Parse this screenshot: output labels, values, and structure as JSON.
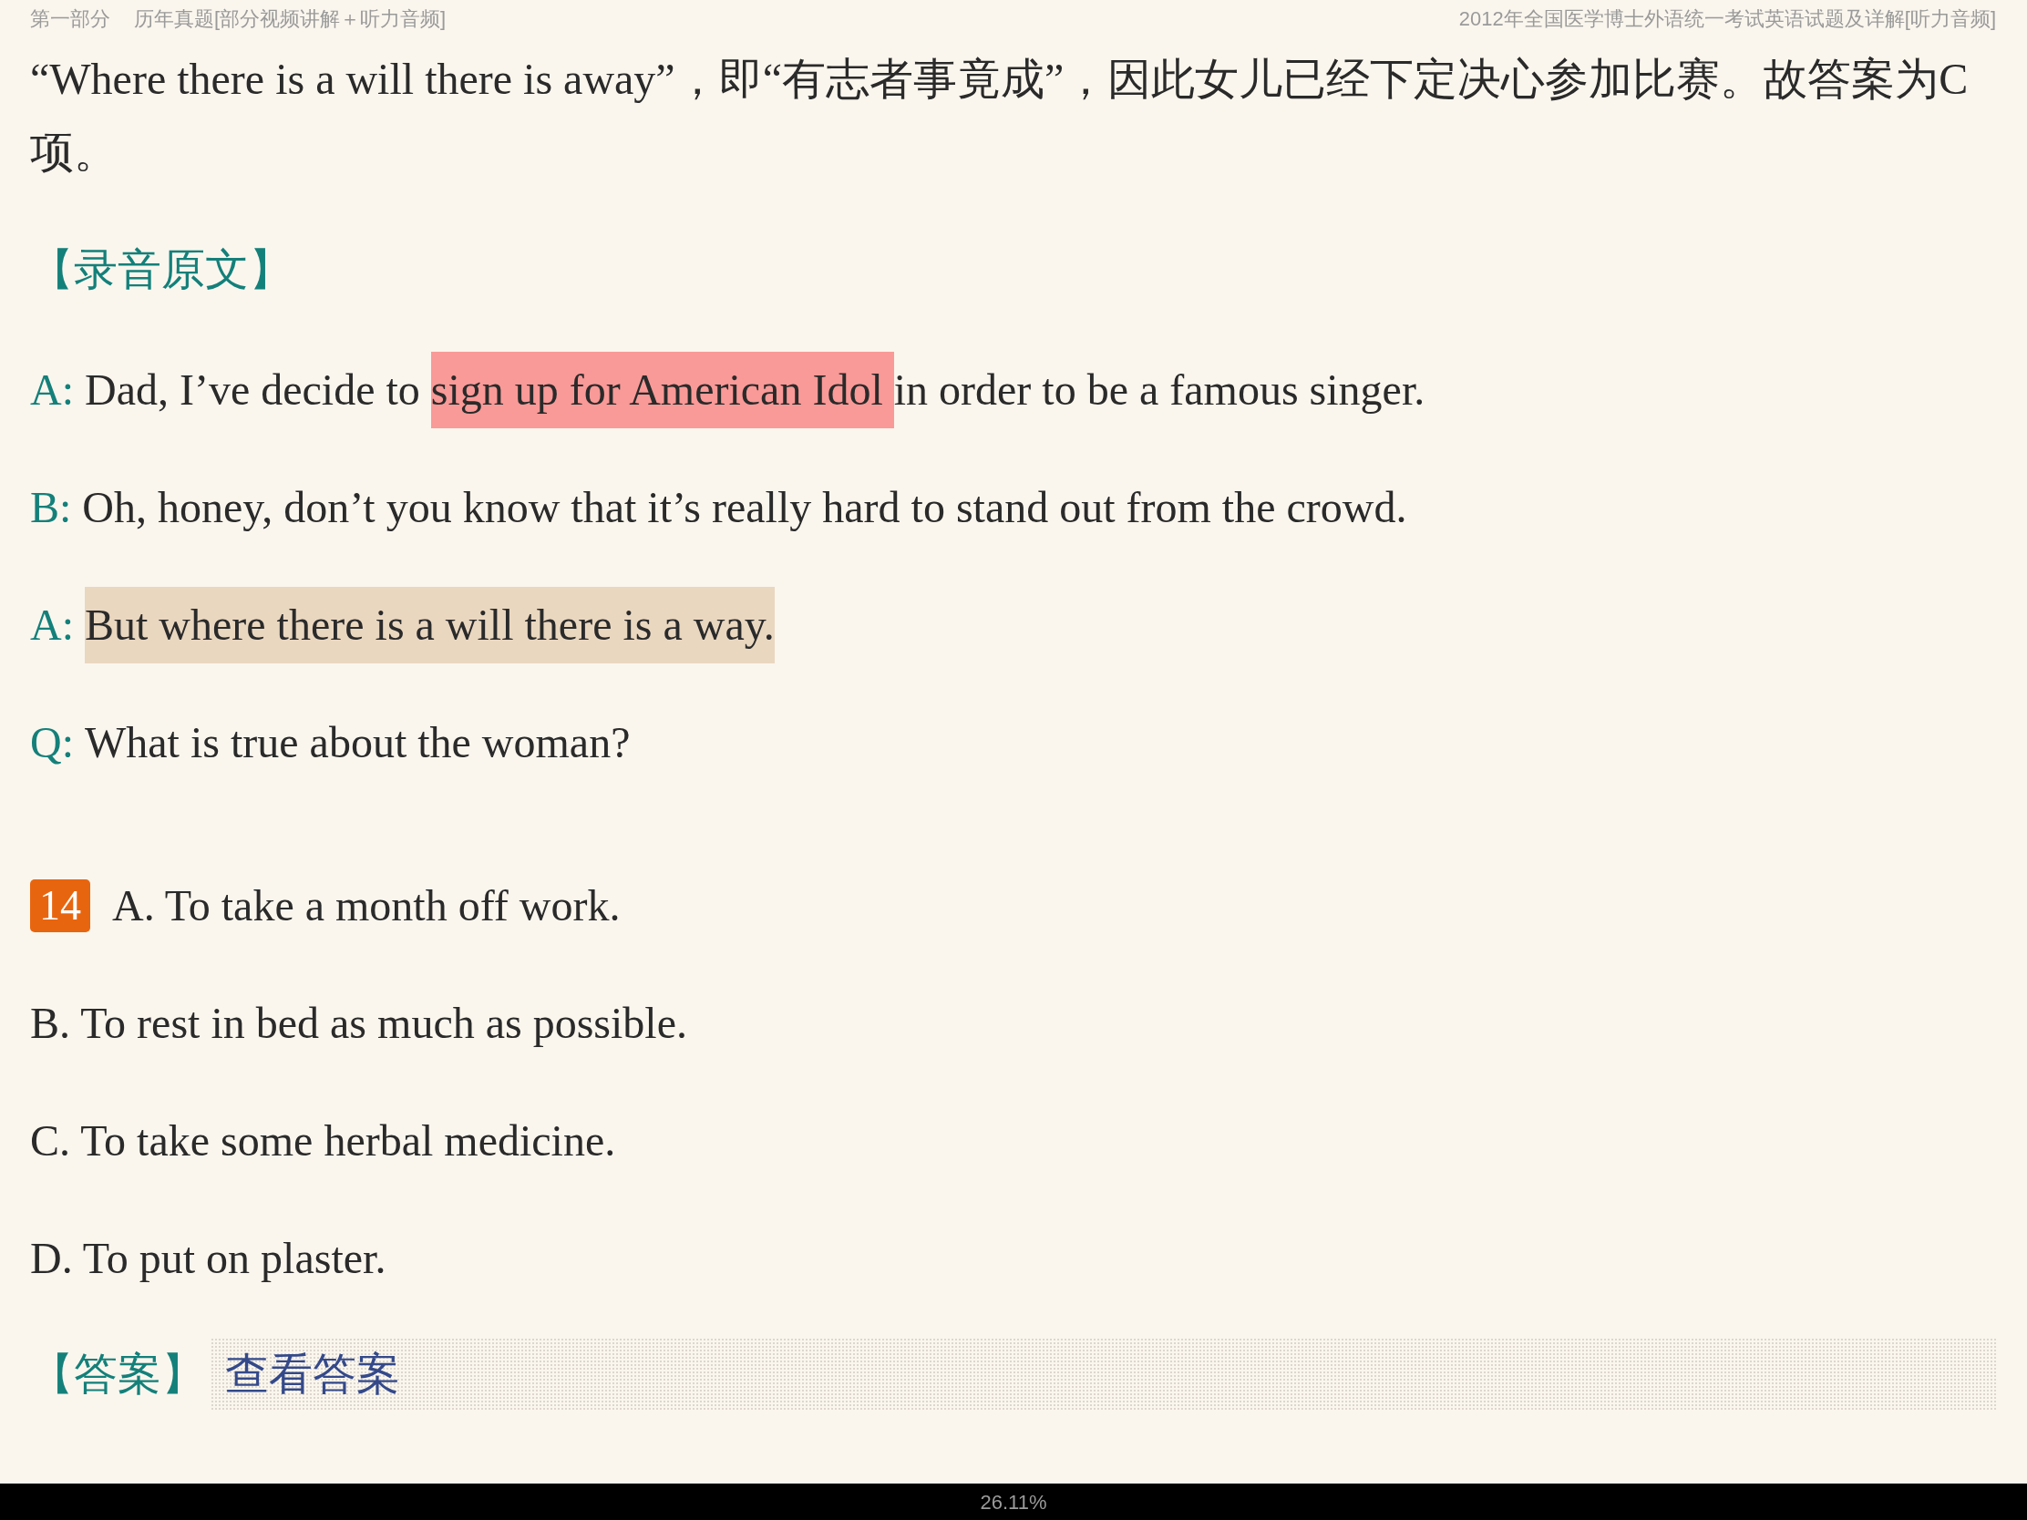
{
  "header": {
    "section": "第一部分",
    "chapter": "历年真题[部分视频讲解＋听力音频]",
    "book_title": "2012年全国医学博士外语统一考试英语试题及详解[听力音频]"
  },
  "explanation_tail": "“Where there is a will there is away”，即“有志者事竟成”，因此女儿已经下定决心参加比赛。故答案为C项。",
  "transcript_heading": "【录音原文】",
  "dialogue": [
    {
      "speaker": "A:",
      "segments": [
        {
          "text": "Dad, I’ve decide to "
        },
        {
          "text": "sign up for American Idol ",
          "color": "#f99a98"
        },
        {
          "text": "in order to be a famous singer."
        }
      ]
    },
    {
      "speaker": "B:",
      "segments": [
        {
          "text": "Oh, honey, don’t you know that it’s really hard to stand out from the crowd."
        }
      ]
    },
    {
      "speaker": "A:",
      "segments": [
        {
          "text": "But where there is a will there is a way.",
          "color": "#ead7c0"
        }
      ]
    },
    {
      "speaker": "Q:",
      "segments": [
        {
          "text": "What is true about the woman?"
        }
      ]
    }
  ],
  "question": {
    "number": "14",
    "options": [
      "A. To take a month off work.",
      "B. To rest in bed as much as possible.",
      "C. To take some herbal medicine.",
      "D. To put on plaster."
    ]
  },
  "answer": {
    "label": "【答案】",
    "link": "查看答案"
  },
  "zoom_level": "26.11%"
}
